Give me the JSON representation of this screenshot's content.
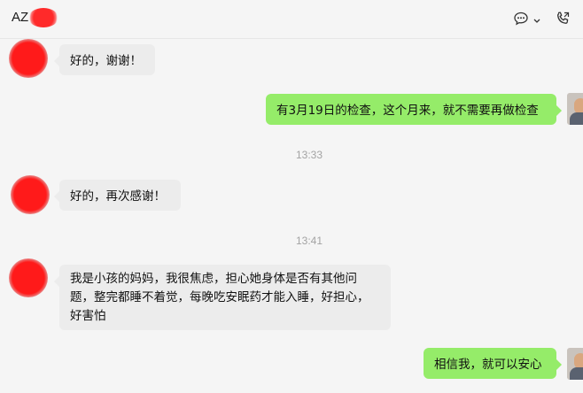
{
  "header": {
    "title": "AZ",
    "icons": [
      "chat-bubble-icon",
      "chevron-down-icon",
      "phone-icon"
    ]
  },
  "messages": [
    {
      "side": "in",
      "text": "好的，谢谢！"
    },
    {
      "side": "out",
      "text": "有3月19日的检查，这个月来，就不需要再做检查"
    },
    {
      "time": "13:33"
    },
    {
      "side": "in",
      "text": "好的，再次感谢！"
    },
    {
      "time": "13:41"
    },
    {
      "side": "in",
      "lines": [
        "我是小孩的妈妈，我很焦虑，担心她身体是否有其他问",
        "题，整完都睡不着觉，每晚吃安眠药才能入睡，好担心，",
        "好害怕"
      ]
    },
    {
      "side": "out",
      "text": "相信我，就可以安心"
    }
  ],
  "colors": {
    "outgoing_bubble": "#95ec69",
    "incoming_bubble": "#ececec",
    "background": "#f5f5f5"
  }
}
